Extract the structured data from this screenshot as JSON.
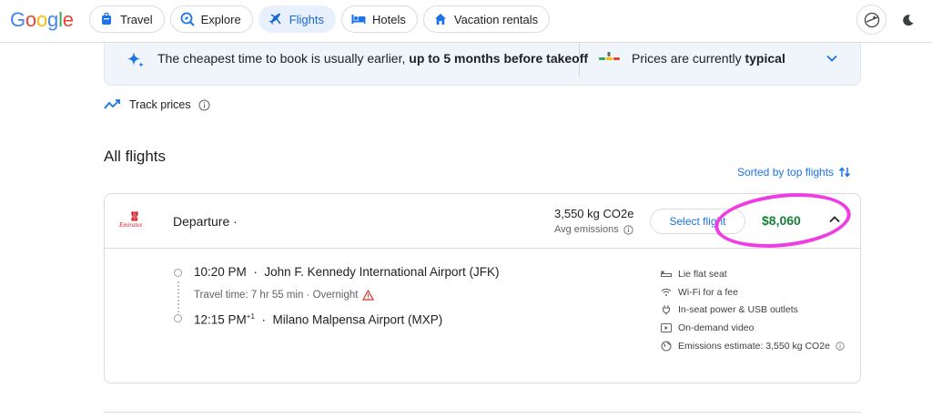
{
  "logo": {
    "text": "Google"
  },
  "nav": {
    "chips": [
      {
        "label": "Travel",
        "icon": "suitcase-icon",
        "active": false
      },
      {
        "label": "Explore",
        "icon": "explore-icon",
        "active": false
      },
      {
        "label": "Flights",
        "icon": "airplane-icon",
        "active": true
      },
      {
        "label": "Hotels",
        "icon": "bed-icon",
        "active": false
      },
      {
        "label": "Vacation rentals",
        "icon": "house-icon",
        "active": false
      }
    ]
  },
  "banner": {
    "tip_prefix": "The cheapest time to book is usually earlier, ",
    "tip_bold": "up to 5 months before takeoff",
    "status_prefix": "Prices are currently ",
    "status_bold": "typical"
  },
  "track": {
    "label": "Track prices"
  },
  "section": {
    "title": "All flights",
    "sort_label": "Sorted by top flights"
  },
  "flight": {
    "airline": "Emirates",
    "departure_label": "Departure ·",
    "emissions": "3,550 kg CO2e",
    "avg_emissions": "Avg emissions",
    "select_label": "Select flight",
    "price": "$8,060",
    "dep_time": "10:20 PM",
    "dep_airport": "John F. Kennedy International Airport (JFK)",
    "travel_time": "Travel time: 7 hr 55 min · Overnight",
    "arr_time": "12:15 PM",
    "arr_day_offset": "+1",
    "arr_airport": "Milano Malpensa Airport (MXP)",
    "amenities": [
      {
        "label": "Lie flat seat",
        "icon": "seat-icon"
      },
      {
        "label": "Wi-Fi for a fee",
        "icon": "wifi-icon"
      },
      {
        "label": "In-seat power & USB outlets",
        "icon": "power-plug-icon"
      },
      {
        "label": "On-demand video",
        "icon": "video-icon"
      },
      {
        "label": "Emissions estimate: 3,550 kg CO2e",
        "icon": "globe-icon"
      }
    ]
  },
  "colors": {
    "accent": "#1a73e8",
    "price": "#188038",
    "annotation": "#ee3de3",
    "warning": "#d93025"
  }
}
